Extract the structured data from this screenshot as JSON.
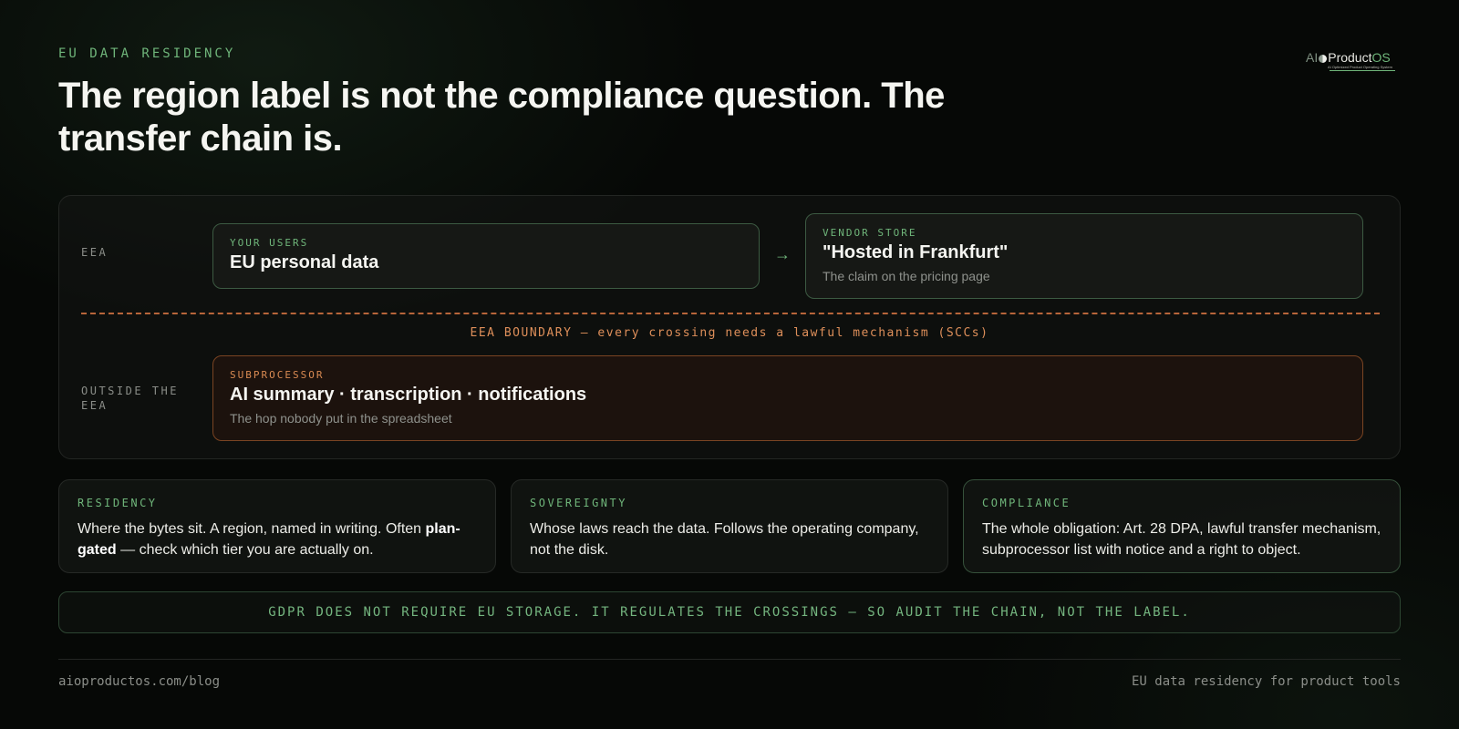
{
  "header": {
    "eyebrow": "EU DATA RESIDENCY",
    "headline": "The region label is not the compliance question. The transfer chain is."
  },
  "logo": {
    "ai": "AI",
    "product": "Product",
    "os": "OS",
    "tagline": "AI Optimized Product Operating System"
  },
  "diagram": {
    "eea_label": "EEA",
    "outside_label": "OUTSIDE THE EEA",
    "users_box": {
      "kicker": "YOUR USERS",
      "title": "EU personal data"
    },
    "arrow": "→",
    "vendor_box": {
      "kicker": "VENDOR STORE",
      "title": "\"Hosted in Frankfurt\"",
      "sub": "The claim on the pricing page"
    },
    "boundary_label": "EEA BOUNDARY — every crossing needs a lawful mechanism (SCCs)",
    "subprocessor_box": {
      "kicker": "SUBPROCESSOR",
      "title": "AI summary · transcription · notifications",
      "sub": "The hop nobody put in the spreadsheet"
    }
  },
  "cards": [
    {
      "kicker": "RESIDENCY",
      "text_a": "Where the bytes sit. A region, named in writing. Often ",
      "bold": "plan-gated",
      "text_b": " — check which tier you are actually on."
    },
    {
      "kicker": "SOVEREIGNTY",
      "text": "Whose laws reach the data. Follows the operating company, not the disk."
    },
    {
      "kicker": "COMPLIANCE",
      "text": "The whole obligation: Art. 28 DPA, lawful transfer mechanism, subprocessor list with notice and a right to object."
    }
  ],
  "banner": "GDPR DOES NOT REQUIRE EU STORAGE. IT REGULATES THE CROSSINGS — SO AUDIT THE CHAIN, NOT THE LABEL.",
  "footer": {
    "left": "aioproductos.com/blog",
    "right": "EU data residency for product tools"
  }
}
